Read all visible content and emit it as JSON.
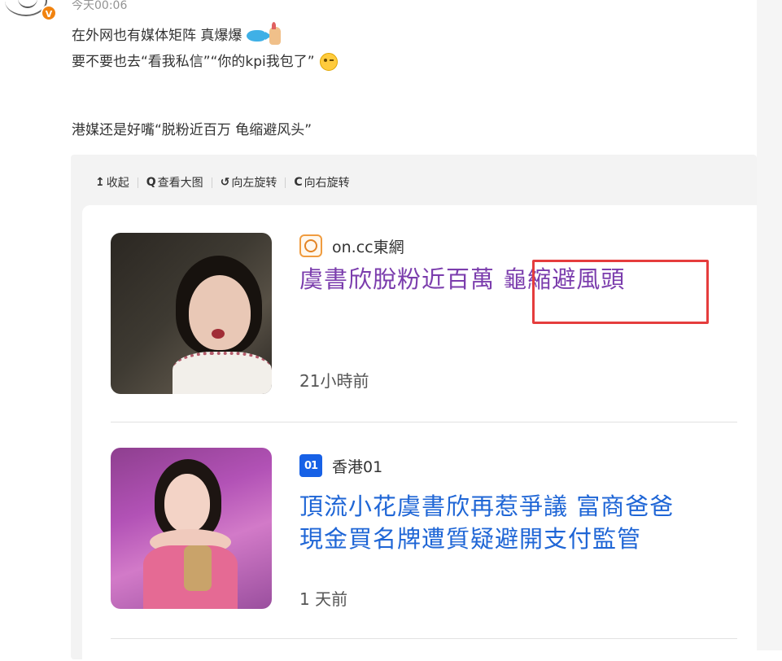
{
  "post": {
    "timestamp": "今天00:06",
    "verified_badge": "V",
    "lines": [
      "在外网也有媒体矩阵 真爆爆",
      "要不要也去“看我私信”“你的kpi我包了”",
      "",
      "港媒还是好嘴“脱粉近百万 龟缩避风头”"
    ],
    "emojis": [
      "fish-emoji",
      "fingers-crossed-emoji",
      "wink-emoji"
    ]
  },
  "toolbar": {
    "collapse": "收起",
    "view_large": "查看大图",
    "rotate_left": "向左旋转",
    "rotate_right": "向右旋转",
    "collapse_icon": "↥",
    "view_large_icon": "Q",
    "rotate_left_icon": "↺",
    "rotate_right_icon": "C"
  },
  "articles": [
    {
      "source": "on.cc東網",
      "source_logo": "oncc-logo-icon",
      "headline_part1": "虞書欣脫粉近百萬 ",
      "headline_part2": "龜縮避風頭",
      "time": "21小時前",
      "headline_color": "#7b3dad"
    },
    {
      "source": "香港01",
      "source_logo_text": "01",
      "headline_line1": "頂流小花虞書欣再惹爭議 富商爸爸",
      "headline_line2": "現金買名牌遭質疑避開支付監管",
      "time": "1 天前",
      "headline_color": "#1f66d6"
    }
  ],
  "colors": {
    "highlight": "#e53d3d",
    "verified": "#f1830f",
    "hk01_brand": "#1761e6",
    "oncc_brand": "#f09c3f"
  }
}
